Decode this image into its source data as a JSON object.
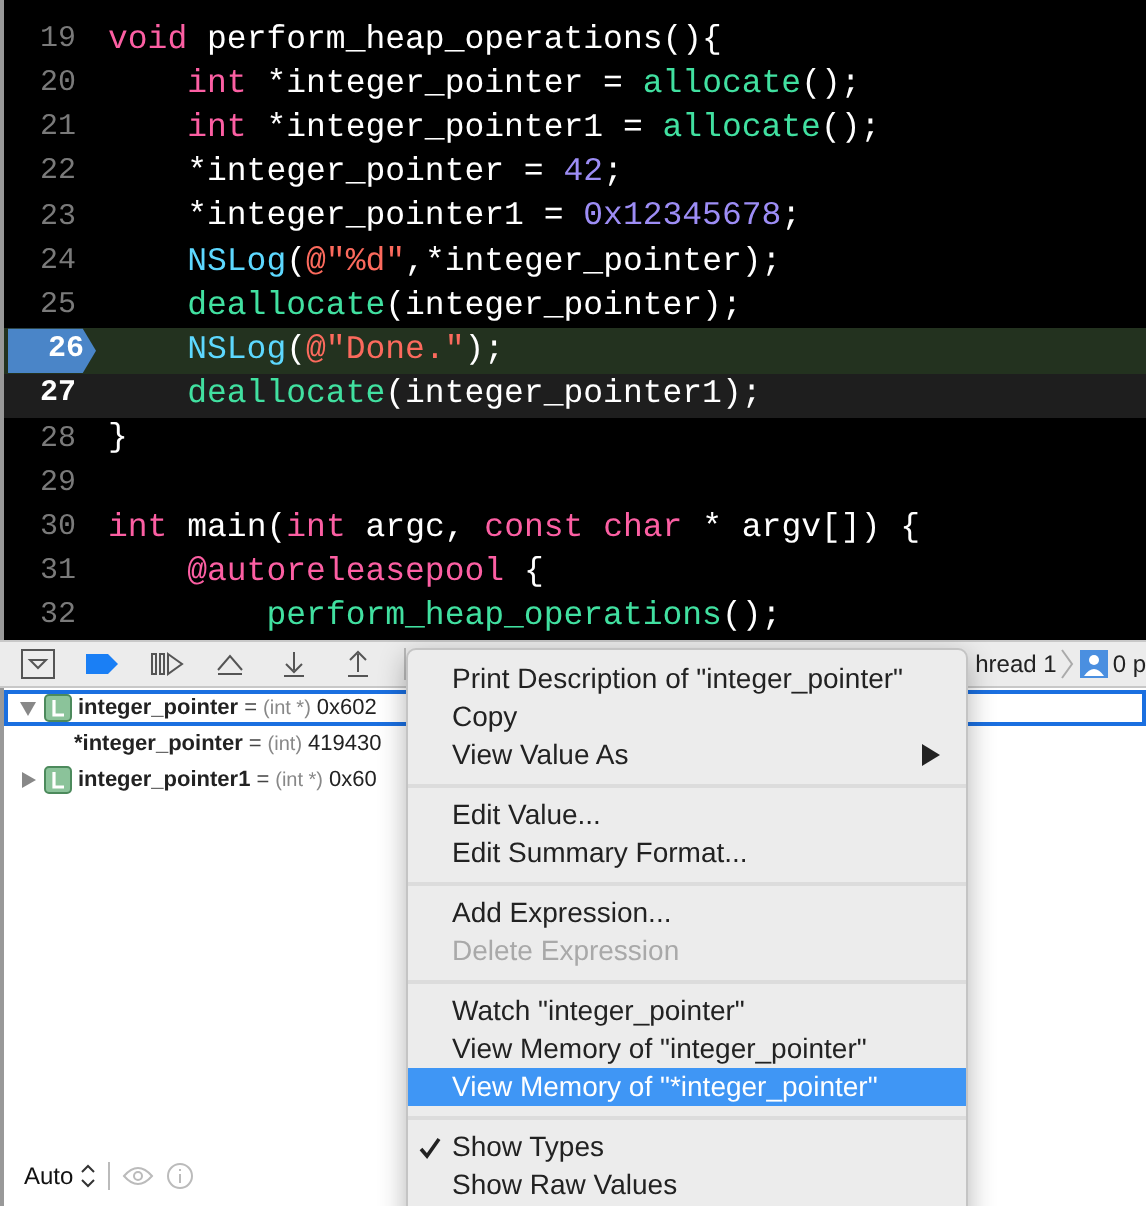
{
  "editor": {
    "lines": [
      {
        "number": "19",
        "kind": "normal",
        "tokens": [
          {
            "kind": "keyword",
            "text": "void"
          },
          {
            "kind": "plain",
            "text": " perform_heap_operations(){"
          }
        ]
      },
      {
        "number": "20",
        "kind": "normal",
        "tokens": [
          {
            "kind": "keyword",
            "text": "    int"
          },
          {
            "kind": "plain",
            "text": " *integer_pointer = "
          },
          {
            "kind": "function",
            "text": "allocate"
          },
          {
            "kind": "plain",
            "text": "();"
          }
        ]
      },
      {
        "number": "21",
        "kind": "normal",
        "tokens": [
          {
            "kind": "keyword",
            "text": "    int"
          },
          {
            "kind": "plain",
            "text": " *integer_pointer1 = "
          },
          {
            "kind": "function",
            "text": "allocate"
          },
          {
            "kind": "plain",
            "text": "();"
          }
        ]
      },
      {
        "number": "22",
        "kind": "normal",
        "tokens": [
          {
            "kind": "plain",
            "text": "    *integer_pointer = "
          },
          {
            "kind": "number",
            "text": "42"
          },
          {
            "kind": "plain",
            "text": ";"
          }
        ]
      },
      {
        "number": "23",
        "kind": "normal",
        "tokens": [
          {
            "kind": "plain",
            "text": "    *integer_pointer1 = "
          },
          {
            "kind": "number",
            "text": "0x12345678"
          },
          {
            "kind": "plain",
            "text": ";"
          }
        ]
      },
      {
        "number": "24",
        "kind": "normal",
        "tokens": [
          {
            "kind": "macro",
            "text": "    NSLog"
          },
          {
            "kind": "plain",
            "text": "("
          },
          {
            "kind": "string",
            "text": "@\"%d\""
          },
          {
            "kind": "plain",
            "text": ",*integer_pointer);"
          }
        ]
      },
      {
        "number": "25",
        "kind": "normal",
        "tokens": [
          {
            "kind": "function",
            "text": "    deallocate"
          },
          {
            "kind": "plain",
            "text": "(integer_pointer);"
          }
        ]
      },
      {
        "number": "26",
        "kind": "stopped",
        "tokens": [
          {
            "kind": "macro",
            "text": "    NSLog"
          },
          {
            "kind": "plain",
            "text": "("
          },
          {
            "kind": "string",
            "text": "@\"Done.\""
          },
          {
            "kind": "plain",
            "text": ");"
          }
        ]
      },
      {
        "number": "27",
        "kind": "cursor",
        "tokens": [
          {
            "kind": "function",
            "text": "    deallocate"
          },
          {
            "kind": "plain",
            "text": "(integer_pointer1);"
          }
        ]
      },
      {
        "number": "28",
        "kind": "normal",
        "tokens": [
          {
            "kind": "plain",
            "text": "}"
          }
        ]
      },
      {
        "number": "29",
        "kind": "normal"
      },
      {
        "number": "30",
        "kind": "normal",
        "tokens": [
          {
            "kind": "keyword",
            "text": "int"
          },
          {
            "kind": "plain",
            "text": " main("
          },
          {
            "kind": "keyword",
            "text": "int"
          },
          {
            "kind": "plain",
            "text": " argc, "
          },
          {
            "kind": "keyword",
            "text": "const char"
          },
          {
            "kind": "plain",
            "text": " * argv[]) {"
          }
        ]
      },
      {
        "number": "31",
        "kind": "normal",
        "tokens": [
          {
            "kind": "keyword",
            "text": "    @autoreleasepool"
          },
          {
            "kind": "plain",
            "text": " {"
          }
        ]
      },
      {
        "number": "32",
        "kind": "normal",
        "tokens": [
          {
            "kind": "function",
            "text": "        perform_heap_operations"
          },
          {
            "kind": "plain",
            "text": "();"
          }
        ]
      }
    ]
  },
  "debug_bar": {
    "thread": "hread 1",
    "process": "0 p"
  },
  "variables": [
    {
      "name": "integer_pointer",
      "operator": "=",
      "type": "(int *)",
      "value": "0x602",
      "expanded": true,
      "selected": true,
      "children": [
        {
          "name": "*integer_pointer",
          "operator": "=",
          "type": "(int)",
          "value": "419430"
        }
      ]
    },
    {
      "name": "integer_pointer1",
      "operator": "=",
      "type": "(int *)",
      "value": "0x60",
      "expanded": false,
      "selected": false
    }
  ],
  "variables_footer": {
    "scope": "Auto"
  },
  "context_menu": {
    "items": [
      {
        "kind": "item",
        "label": "Print Description of \"integer_pointer\"",
        "disabled": false,
        "selected": false,
        "checked": false,
        "submenu": false
      },
      {
        "kind": "item",
        "label": "Copy",
        "disabled": false,
        "selected": false,
        "checked": false,
        "submenu": false
      },
      {
        "kind": "item",
        "label": "View Value As",
        "disabled": false,
        "selected": false,
        "checked": false,
        "submenu": true
      },
      {
        "kind": "separator"
      },
      {
        "kind": "item",
        "label": "Edit Value...",
        "disabled": false,
        "selected": false,
        "checked": false,
        "submenu": false
      },
      {
        "kind": "item",
        "label": "Edit Summary Format...",
        "disabled": false,
        "selected": false,
        "checked": false,
        "submenu": false
      },
      {
        "kind": "separator"
      },
      {
        "kind": "item",
        "label": "Add Expression...",
        "disabled": false,
        "selected": false,
        "checked": false,
        "submenu": false
      },
      {
        "kind": "item",
        "label": "Delete Expression",
        "disabled": true,
        "selected": false,
        "checked": false,
        "submenu": false
      },
      {
        "kind": "separator"
      },
      {
        "kind": "item",
        "label": "Watch \"integer_pointer\"",
        "disabled": false,
        "selected": false,
        "checked": false,
        "submenu": false
      },
      {
        "kind": "item",
        "label": "View Memory of \"integer_pointer\"",
        "disabled": false,
        "selected": false,
        "checked": false,
        "submenu": false
      },
      {
        "kind": "item",
        "label": "View Memory of \"*integer_pointer\"",
        "disabled": false,
        "selected": true,
        "checked": false,
        "submenu": false
      },
      {
        "kind": "separator"
      },
      {
        "kind": "item",
        "label": "Show Types",
        "disabled": false,
        "selected": false,
        "checked": true,
        "submenu": false
      },
      {
        "kind": "item",
        "label": "Show Raw Values",
        "disabled": false,
        "selected": false,
        "checked": false,
        "submenu": false
      }
    ]
  }
}
